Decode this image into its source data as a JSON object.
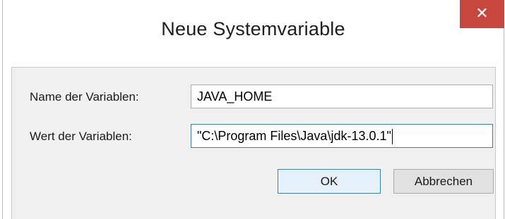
{
  "dialog": {
    "title": "Neue Systemvariable",
    "close_glyph": "✕"
  },
  "form": {
    "name_label": "Name der Variablen:",
    "name_value": "JAVA_HOME",
    "value_label": "Wert der Variablen:",
    "value_value": "\"C:\\Program Files\\Java\\jdk-13.0.1\""
  },
  "buttons": {
    "ok_label": "OK",
    "cancel_label": "Abbrechen"
  },
  "colors": {
    "close_button": "#c7463d",
    "focus_border": "#3c7fb1",
    "client_background": "#f0f0f0"
  }
}
